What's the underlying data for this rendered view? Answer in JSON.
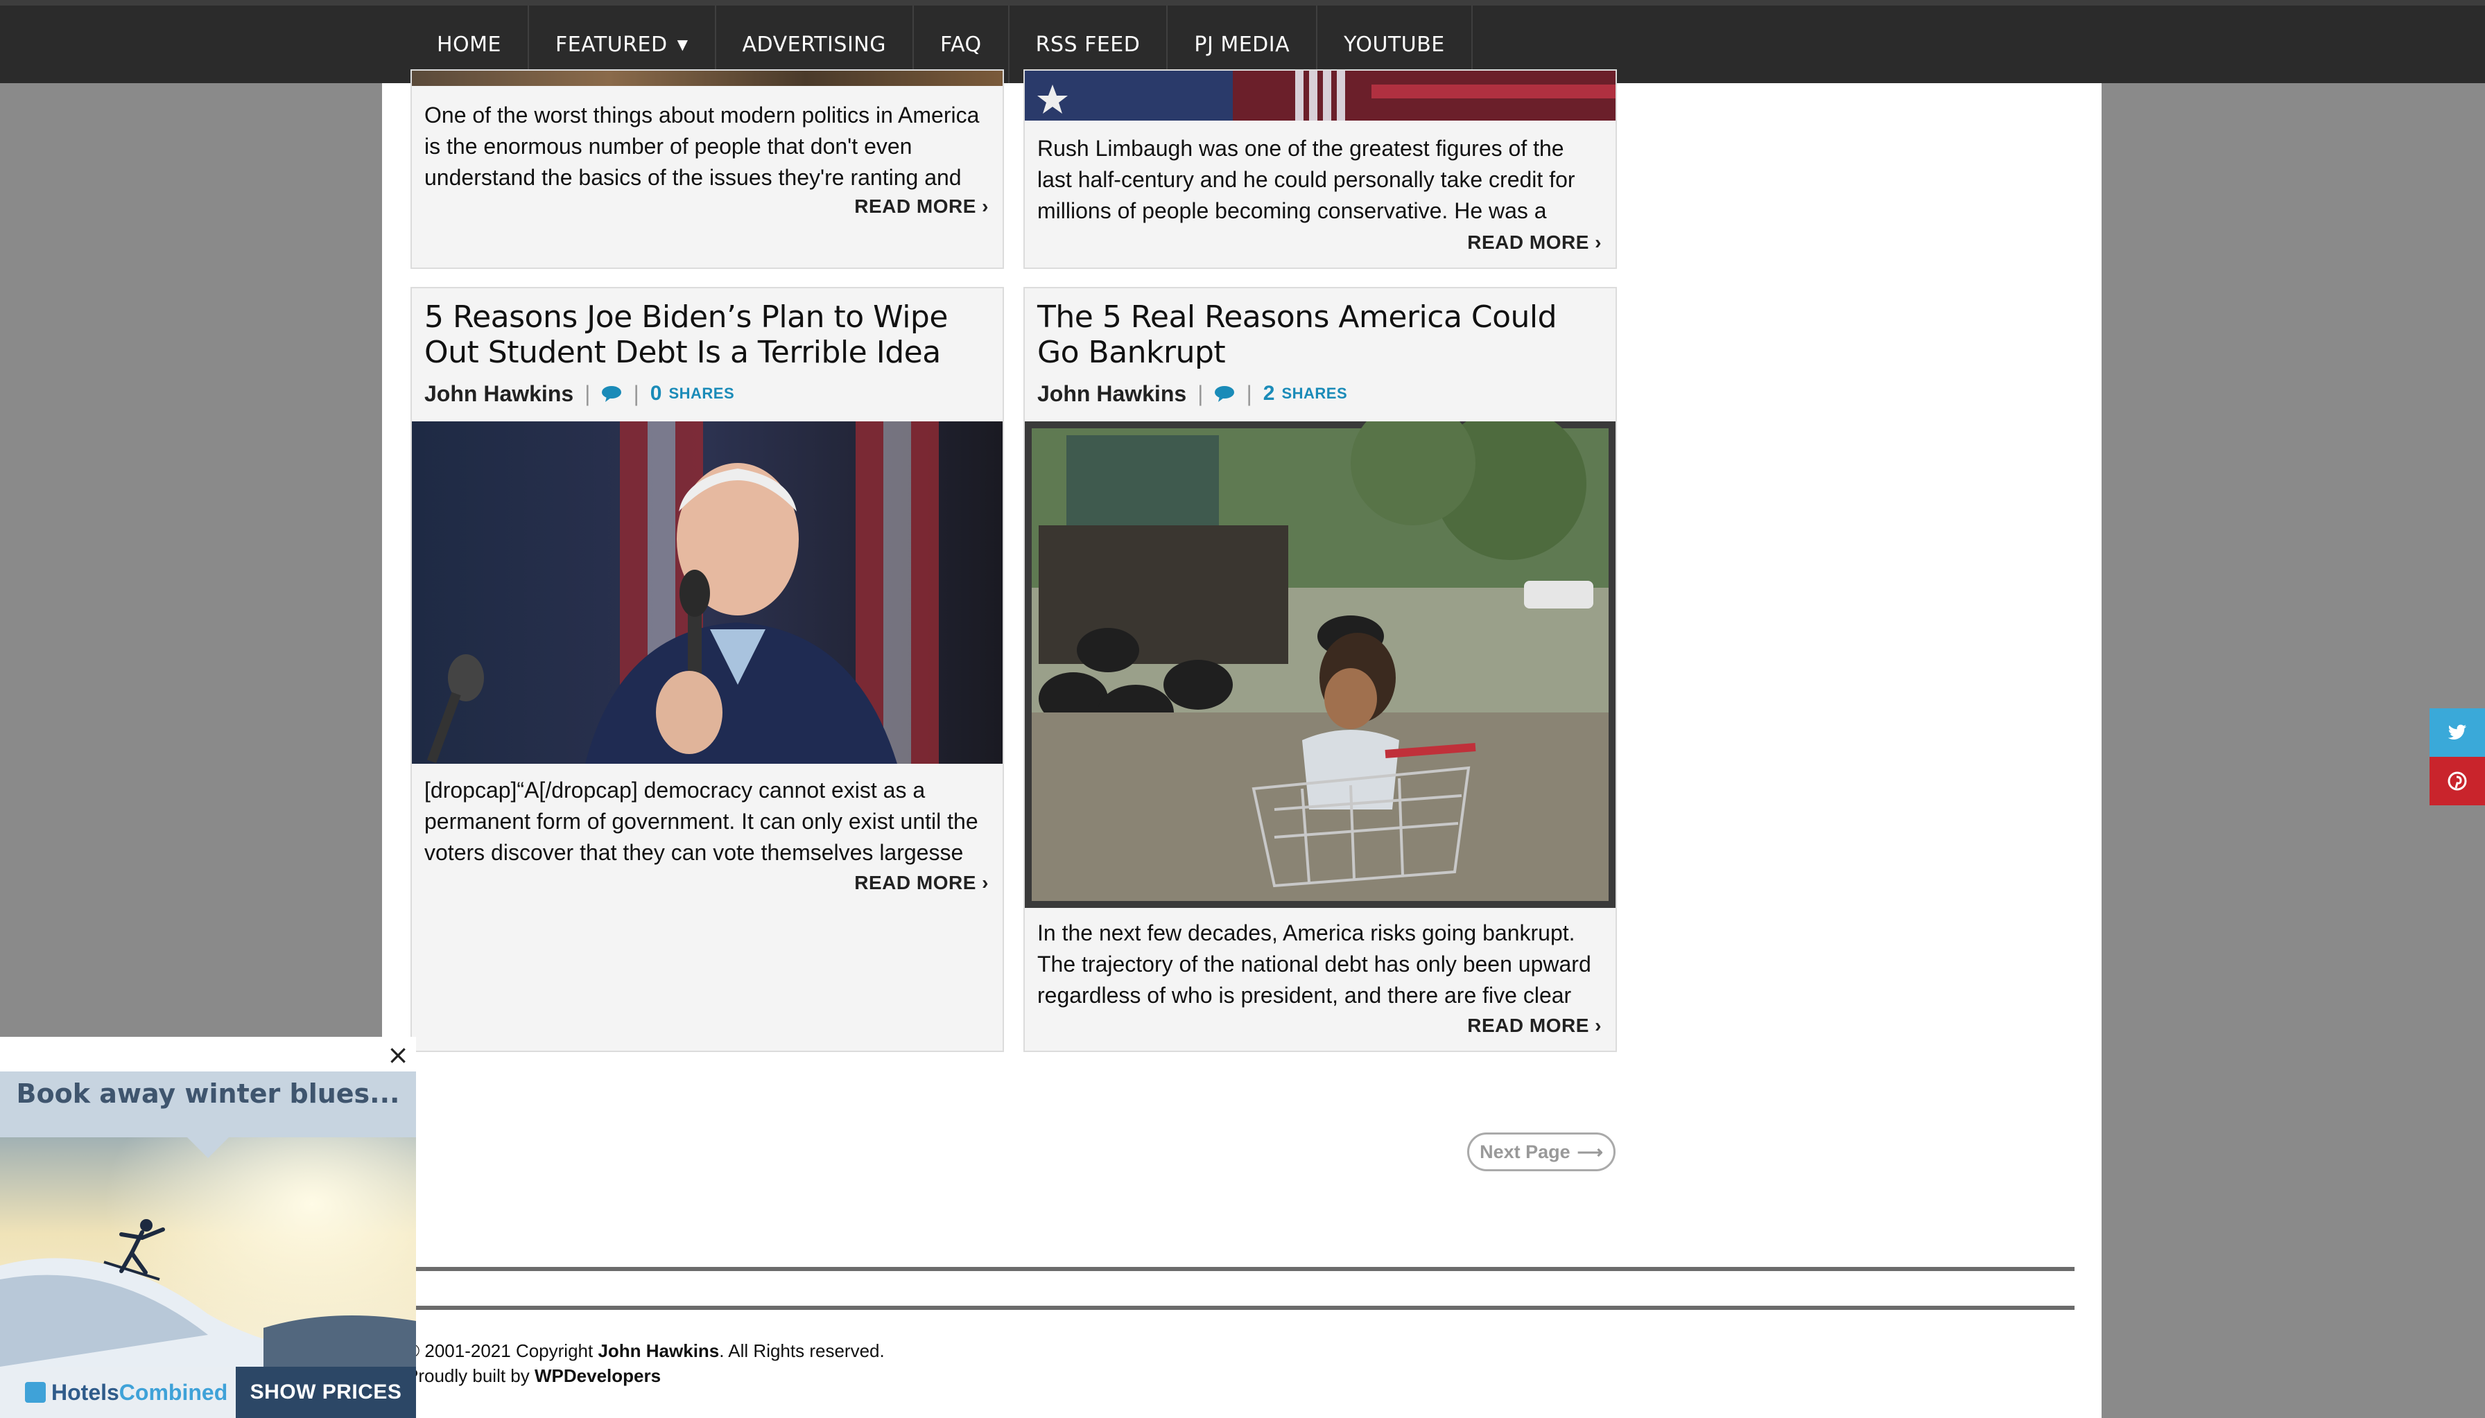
{
  "nav": {
    "items": [
      {
        "label": "HOME"
      },
      {
        "label": "FEATURED",
        "has_dropdown": true
      },
      {
        "label": "ADVERTISING"
      },
      {
        "label": "FAQ"
      },
      {
        "label": "RSS FEED"
      },
      {
        "label": "PJ MEDIA"
      },
      {
        "label": "YOUTUBE"
      }
    ]
  },
  "articles": {
    "top_left": {
      "excerpt": "One of the worst things about modern politics in America is the enormous number of people that don't even understand the basics of the issues they're ranting and",
      "read_more": "READ MORE"
    },
    "top_right": {
      "excerpt": "Rush Limbaugh was one of the greatest figures of the last half-century and he could personally take credit for millions of people becoming conservative. He was a",
      "read_more": "READ MORE"
    },
    "biden": {
      "title": "5 Reasons Joe Biden’s Plan to Wipe Out Student Debt Is a Terrible Idea",
      "author": "John Hawkins",
      "share_count": "0",
      "share_label": "SHARES",
      "excerpt": "[dropcap]“A[/dropcap] democracy cannot exist as a permanent form of government. It can only exist until the voters discover that they can vote themselves largesse",
      "read_more": "READ MORE"
    },
    "bankrupt": {
      "title": "The 5 Real Reasons America Could Go Bankrupt",
      "author": "John Hawkins",
      "share_count": "2",
      "share_label": "SHARES",
      "excerpt": "In the next few decades, America risks going bankrupt. The trajectory of the national debt has only been upward regardless of who is president, and there are five clear",
      "read_more": "READ MORE"
    }
  },
  "pagination": {
    "next_label": "Next Page"
  },
  "footer": {
    "copyright_prefix": "© 2001-2021 Copyright ",
    "copyright_owner": "John Hawkins",
    "copyright_suffix": ". All Rights reserved.",
    "built_prefix": "Proudly built by ",
    "built_by": "WPDevelopers"
  },
  "social": {
    "twitter_color": "#3aa9d9",
    "pinterest_color": "#c9242c"
  },
  "ad": {
    "headline": "Book away winter blues...",
    "brand_part1": "Hotels",
    "brand_part2": "Combined",
    "cta": "SHOW PRICES",
    "close": "×"
  },
  "colors": {
    "accent": "#1a8bb8",
    "nav_bg": "#2b2b2b"
  }
}
